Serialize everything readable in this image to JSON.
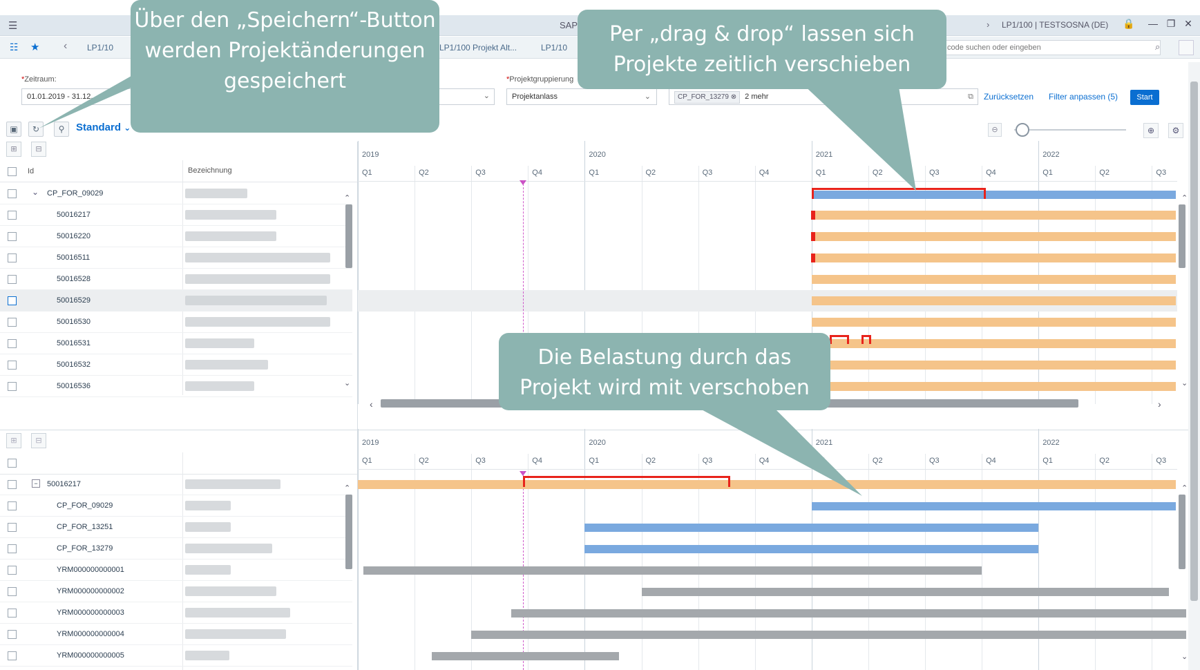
{
  "shell": {
    "app_title": "SAP",
    "user_info": "LP1/100 | TESTSOSNA (DE)",
    "menu_icon": "hamburger-icon"
  },
  "tabs": [
    {
      "label": "LP1/10"
    },
    {
      "label": "LP1/100 Projekt Alt..."
    },
    {
      "label": "LP1/10"
    }
  ],
  "search": {
    "placeholder": "code suchen oder eingeben"
  },
  "filters": {
    "zeitraum_label": "Zeitraum:",
    "zeitraum_value": "01.01.2019 - 31.12...",
    "gruppierung_label": "Projektgruppierung",
    "gruppierung_value": "Projektanlass",
    "token_value": "CP_FOR_13279",
    "more_value": "2 mehr",
    "reset_label": "Zurücksetzen",
    "adapt_label": "Filter anpassen (5)",
    "start_label": "Start"
  },
  "toolbar": {
    "variant_label": "Standard"
  },
  "table_top": {
    "col_id": "Id",
    "col_bez": "Bezeichnung",
    "rows": [
      {
        "id": "CP_FOR_09029",
        "indent": 0,
        "expand": "v"
      },
      {
        "id": "50016217",
        "indent": 1
      },
      {
        "id": "50016220",
        "indent": 1
      },
      {
        "id": "50016511",
        "indent": 1
      },
      {
        "id": "50016528",
        "indent": 1
      },
      {
        "id": "50016529",
        "indent": 1,
        "selected": true
      },
      {
        "id": "50016530",
        "indent": 1
      },
      {
        "id": "50016531",
        "indent": 1
      },
      {
        "id": "50016532",
        "indent": 1
      },
      {
        "id": "50016536",
        "indent": 1
      }
    ]
  },
  "table_bottom": {
    "rows": [
      {
        "id": "50016217",
        "indent": 0
      },
      {
        "id": "CP_FOR_09029",
        "indent": 1
      },
      {
        "id": "CP_FOR_13251",
        "indent": 1
      },
      {
        "id": "CP_FOR_13279",
        "indent": 1
      },
      {
        "id": "YRM000000000001",
        "indent": 1
      },
      {
        "id": "YRM000000000002",
        "indent": 1
      },
      {
        "id": "YRM000000000003",
        "indent": 1
      },
      {
        "id": "YRM000000000004",
        "indent": 1
      },
      {
        "id": "YRM000000000005",
        "indent": 1
      }
    ]
  },
  "timeline": {
    "years": [
      "2019",
      "2020",
      "2021",
      "2022"
    ],
    "quarters": [
      "Q1",
      "Q2",
      "Q3",
      "Q4",
      "Q1",
      "Q2",
      "Q3",
      "Q4",
      "Q1",
      "Q2",
      "Q3",
      "Q4",
      "Q1",
      "Q2",
      "Q3"
    ]
  },
  "callouts": {
    "save": "Über den „Speichern“-Button werden Projektänderungen gespeichert",
    "drag": "Per „drag & drop“ lassen sich Projekte zeitlich verschieben",
    "load": "Die Belastung durch das Projekt wird mit verschoben"
  },
  "colors": {
    "accent": "#0a6ed1",
    "callout": "#8cb4b0",
    "bar_orange": "#f5c48a",
    "bar_blue": "#7aa9df",
    "bar_gray": "#a4a8ac",
    "highlight_red": "#e8231b"
  }
}
